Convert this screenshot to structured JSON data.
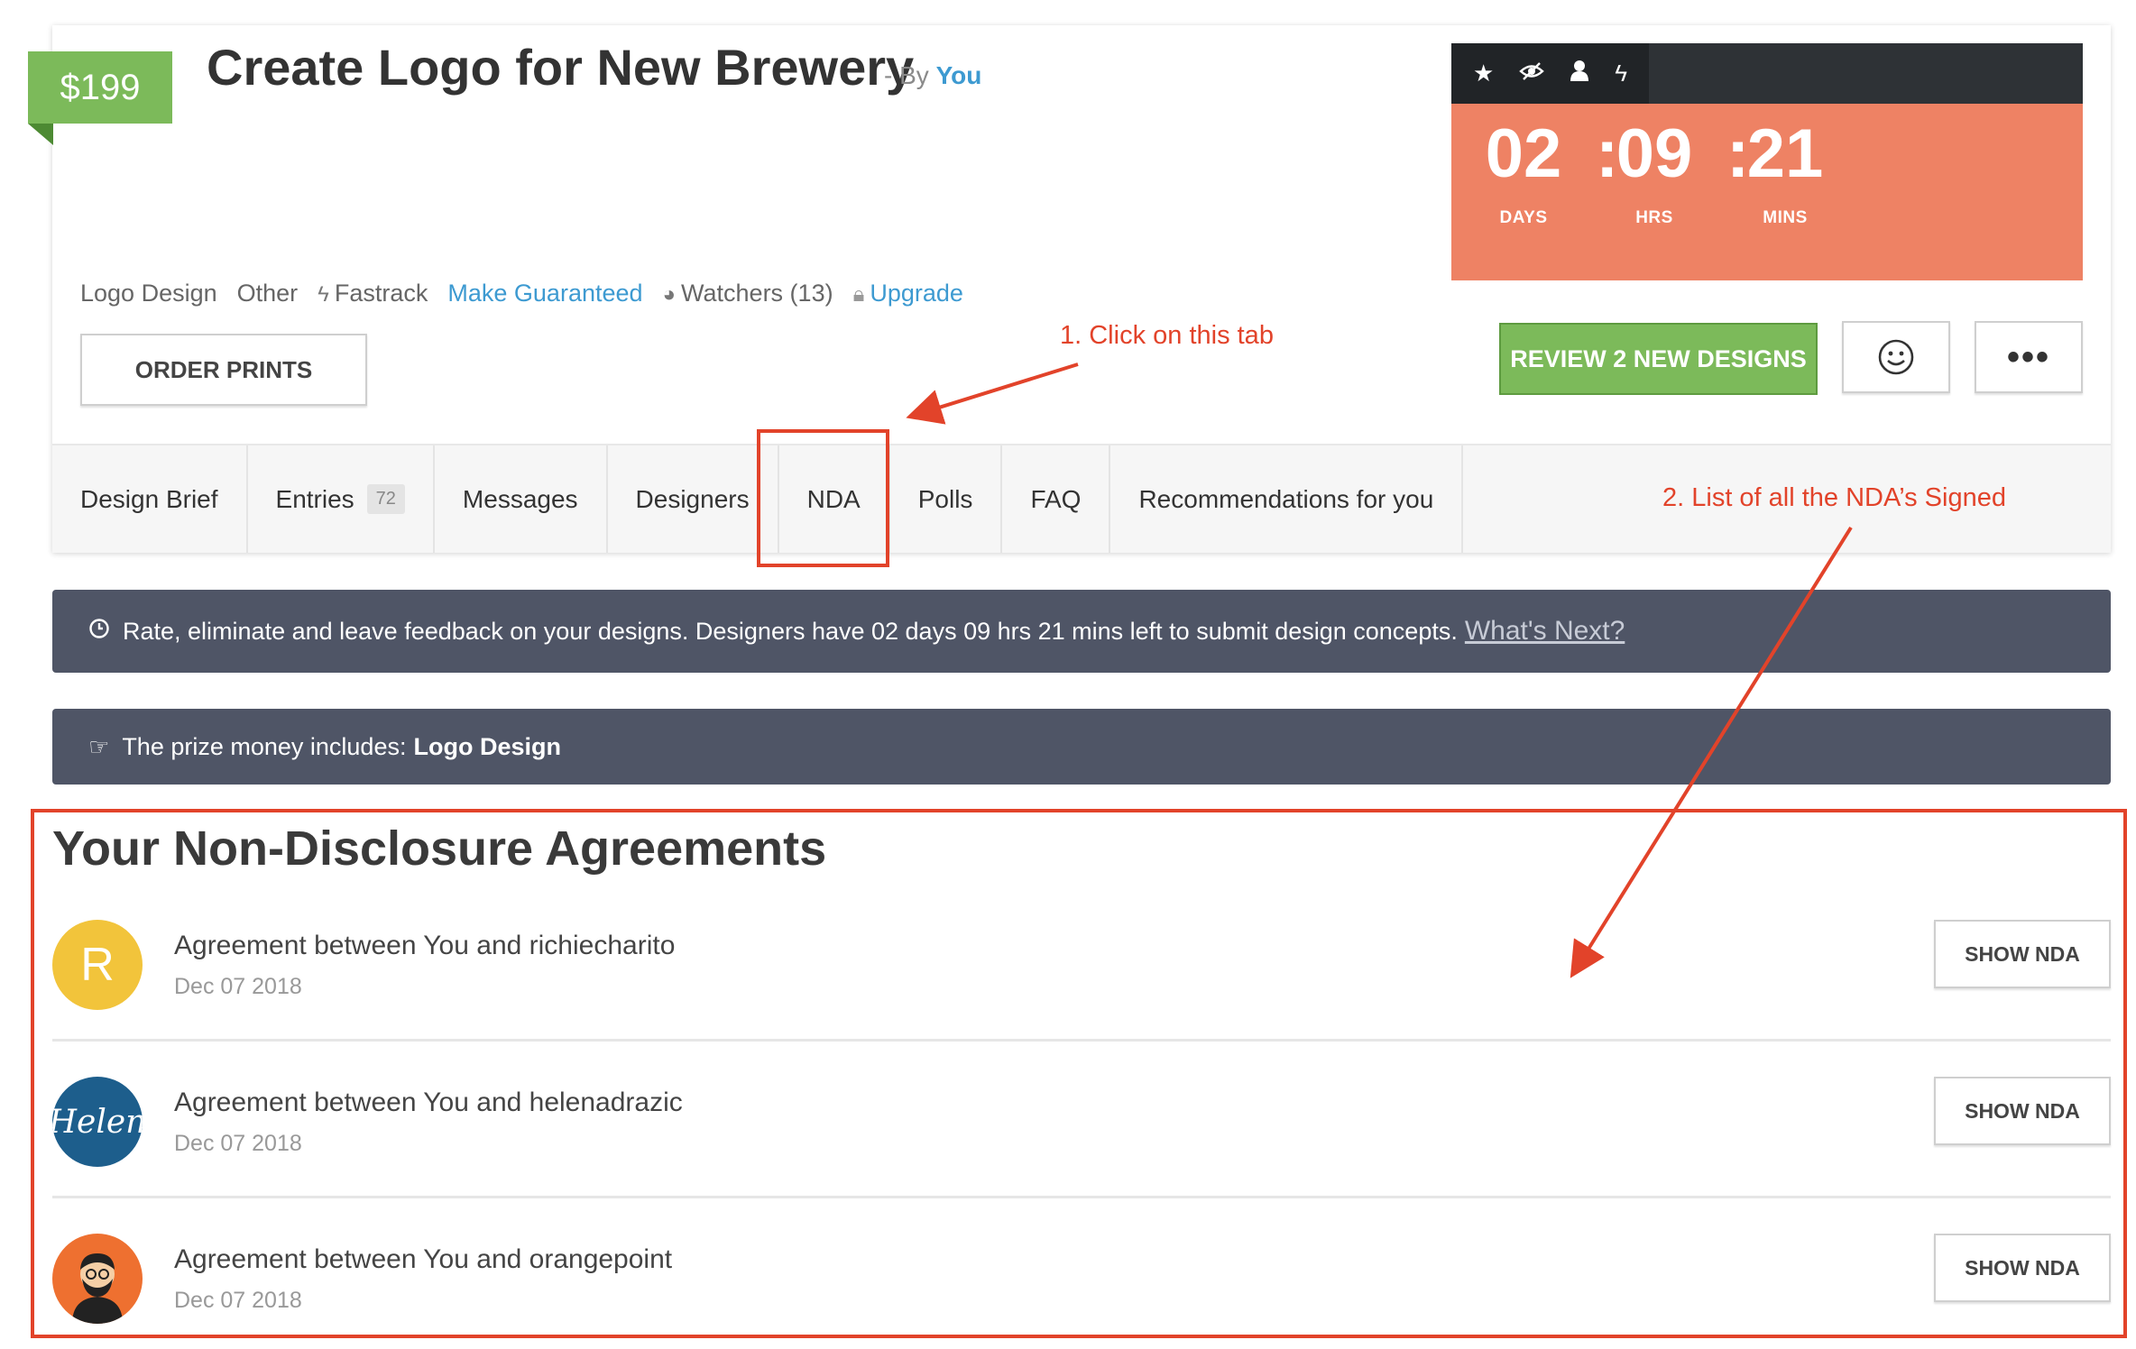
{
  "contest": {
    "price": "$199",
    "title": "Create Logo for New Brewery",
    "by_prefix": "- By",
    "by_user": "You"
  },
  "meta": {
    "category": "Logo Design",
    "other": "Other",
    "fastrack": "Fastrack",
    "make_guaranteed": "Make Guaranteed",
    "watchers": "Watchers (13)",
    "upgrade": "Upgrade"
  },
  "buttons": {
    "order_prints": "ORDER PRINTS",
    "review": "REVIEW 2 NEW DESIGNS",
    "more": "•••"
  },
  "timer": {
    "days": "02",
    "hrs": "09",
    "mins": "21",
    "days_label": "DAYS",
    "hrs_label": "HRS",
    "mins_label": "MINS",
    "sep": ":"
  },
  "tabs": [
    {
      "label": "Design Brief"
    },
    {
      "label": "Entries",
      "badge": "72"
    },
    {
      "label": "Messages"
    },
    {
      "label": "Designers"
    },
    {
      "label": "NDA"
    },
    {
      "label": "Polls"
    },
    {
      "label": "FAQ"
    },
    {
      "label": "Recommendations for you"
    }
  ],
  "banners": {
    "rate_text": "Rate, eliminate and leave feedback on your designs. Designers have 02 days 09 hrs 21 mins left to submit design concepts.",
    "whats_next": "What's Next?",
    "prize_prefix": "The prize money includes:",
    "prize_item": "Logo Design"
  },
  "nda": {
    "heading": "Your Non-Disclosure Agreements",
    "show_label": "SHOW NDA",
    "items": [
      {
        "text": "Agreement between You and richiecharito",
        "date": "Dec 07 2018",
        "avatar_letter": "R"
      },
      {
        "text": "Agreement between You and helenadrazic",
        "date": "Dec 07 2018",
        "avatar_letter": "Helen"
      },
      {
        "text": "Agreement between You and orangepoint",
        "date": "Dec 07 2018"
      }
    ]
  },
  "annotations": {
    "step1": "1. Click on this tab",
    "step2": "2. List of all the NDA’s Signed"
  },
  "colors": {
    "green": "#7cba5a",
    "timer": "#ee8264",
    "banner": "#4f5566",
    "link": "#3d9ad1",
    "annotation": "#e2432a"
  }
}
